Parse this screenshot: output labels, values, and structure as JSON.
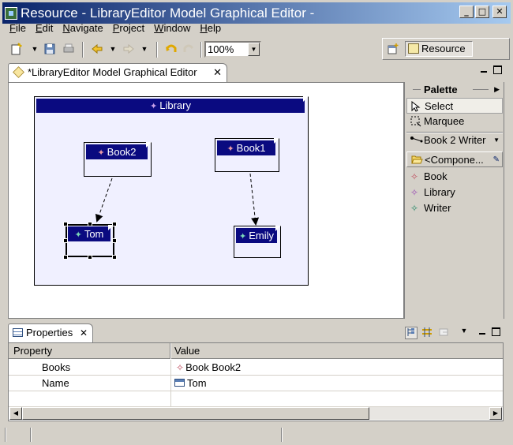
{
  "window": {
    "title": "Resource - LibraryEditor Model Graphical Editor -",
    "controls": {
      "minimize": "_",
      "maximize": "□",
      "close": "✕"
    }
  },
  "menubar": {
    "items": [
      {
        "mnemonic": "F",
        "rest": "ile"
      },
      {
        "mnemonic": "E",
        "rest": "dit"
      },
      {
        "mnemonic": "N",
        "rest": "avigate"
      },
      {
        "mnemonic": "P",
        "rest": "roject"
      },
      {
        "mnemonic": "W",
        "rest": "indow"
      },
      {
        "mnemonic": "H",
        "rest": "elp"
      }
    ]
  },
  "toolbar": {
    "zoom": "100%"
  },
  "perspective": {
    "label": "Resource"
  },
  "editor": {
    "tab_label": "*LibraryEditor Model Graphical Editor",
    "tab_close": "✕"
  },
  "diagram": {
    "library": "Library",
    "book2": "Book2",
    "book1": "Book1",
    "tom": "Tom",
    "emily": "Emily",
    "element_colors": {
      "book": "#c05060",
      "library": "#9a4fb5",
      "writer": "#2a8a6a"
    }
  },
  "palette": {
    "title": "Palette",
    "select": "Select",
    "marquee": "Marquee",
    "connection": "Book 2 Writer",
    "drawer": "<Compone...",
    "tools": [
      "Book",
      "Library",
      "Writer"
    ]
  },
  "properties": {
    "tab_label": "Properties",
    "tab_close": "✕",
    "columns": [
      "Property",
      "Value"
    ],
    "rows": [
      {
        "property": "Books",
        "value": "Book Book2"
      },
      {
        "property": "Name",
        "value": "Tom"
      }
    ]
  }
}
